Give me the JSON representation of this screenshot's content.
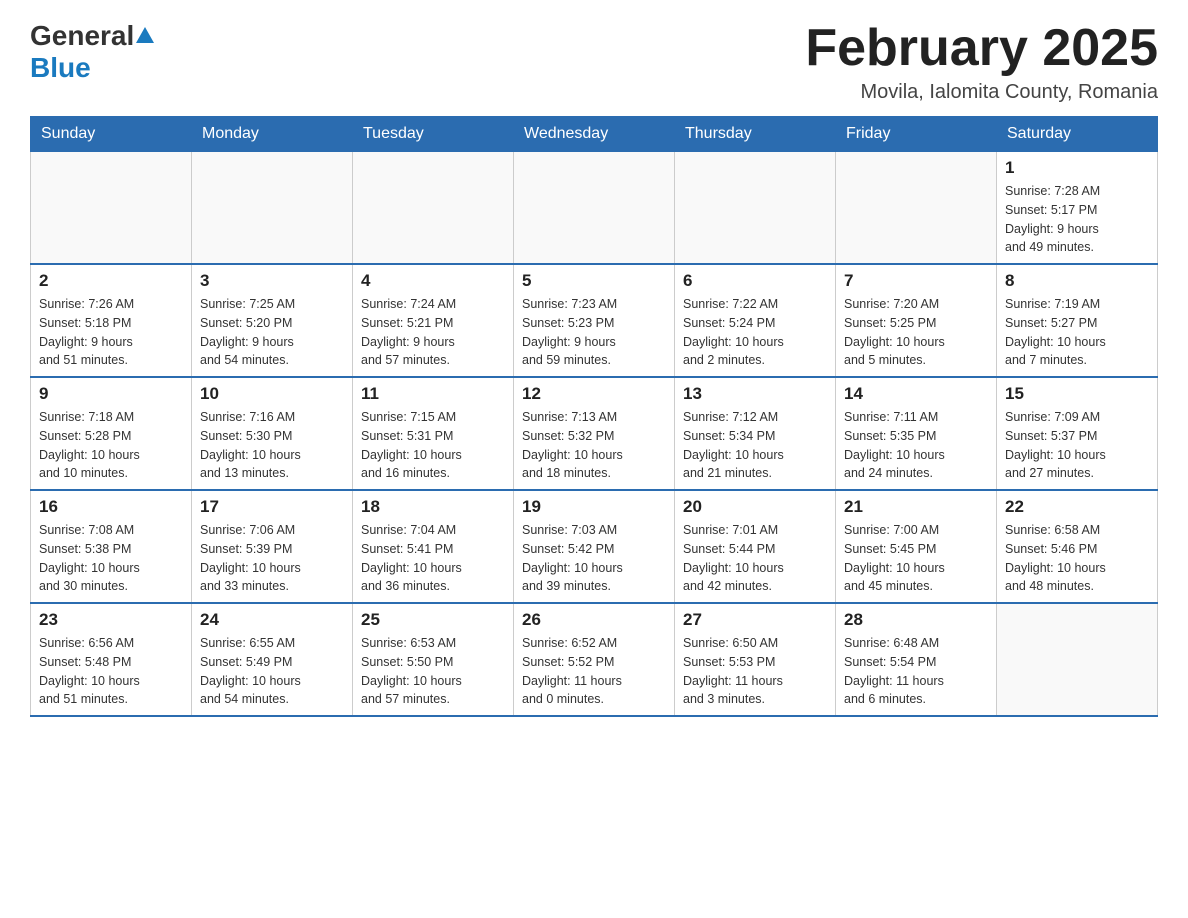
{
  "header": {
    "logo_general": "General",
    "logo_blue": "Blue",
    "month_title": "February 2025",
    "location": "Movila, Ialomita County, Romania"
  },
  "weekdays": [
    "Sunday",
    "Monday",
    "Tuesday",
    "Wednesday",
    "Thursday",
    "Friday",
    "Saturday"
  ],
  "weeks": [
    [
      {
        "day": "",
        "info": ""
      },
      {
        "day": "",
        "info": ""
      },
      {
        "day": "",
        "info": ""
      },
      {
        "day": "",
        "info": ""
      },
      {
        "day": "",
        "info": ""
      },
      {
        "day": "",
        "info": ""
      },
      {
        "day": "1",
        "info": "Sunrise: 7:28 AM\nSunset: 5:17 PM\nDaylight: 9 hours\nand 49 minutes."
      }
    ],
    [
      {
        "day": "2",
        "info": "Sunrise: 7:26 AM\nSunset: 5:18 PM\nDaylight: 9 hours\nand 51 minutes."
      },
      {
        "day": "3",
        "info": "Sunrise: 7:25 AM\nSunset: 5:20 PM\nDaylight: 9 hours\nand 54 minutes."
      },
      {
        "day": "4",
        "info": "Sunrise: 7:24 AM\nSunset: 5:21 PM\nDaylight: 9 hours\nand 57 minutes."
      },
      {
        "day": "5",
        "info": "Sunrise: 7:23 AM\nSunset: 5:23 PM\nDaylight: 9 hours\nand 59 minutes."
      },
      {
        "day": "6",
        "info": "Sunrise: 7:22 AM\nSunset: 5:24 PM\nDaylight: 10 hours\nand 2 minutes."
      },
      {
        "day": "7",
        "info": "Sunrise: 7:20 AM\nSunset: 5:25 PM\nDaylight: 10 hours\nand 5 minutes."
      },
      {
        "day": "8",
        "info": "Sunrise: 7:19 AM\nSunset: 5:27 PM\nDaylight: 10 hours\nand 7 minutes."
      }
    ],
    [
      {
        "day": "9",
        "info": "Sunrise: 7:18 AM\nSunset: 5:28 PM\nDaylight: 10 hours\nand 10 minutes."
      },
      {
        "day": "10",
        "info": "Sunrise: 7:16 AM\nSunset: 5:30 PM\nDaylight: 10 hours\nand 13 minutes."
      },
      {
        "day": "11",
        "info": "Sunrise: 7:15 AM\nSunset: 5:31 PM\nDaylight: 10 hours\nand 16 minutes."
      },
      {
        "day": "12",
        "info": "Sunrise: 7:13 AM\nSunset: 5:32 PM\nDaylight: 10 hours\nand 18 minutes."
      },
      {
        "day": "13",
        "info": "Sunrise: 7:12 AM\nSunset: 5:34 PM\nDaylight: 10 hours\nand 21 minutes."
      },
      {
        "day": "14",
        "info": "Sunrise: 7:11 AM\nSunset: 5:35 PM\nDaylight: 10 hours\nand 24 minutes."
      },
      {
        "day": "15",
        "info": "Sunrise: 7:09 AM\nSunset: 5:37 PM\nDaylight: 10 hours\nand 27 minutes."
      }
    ],
    [
      {
        "day": "16",
        "info": "Sunrise: 7:08 AM\nSunset: 5:38 PM\nDaylight: 10 hours\nand 30 minutes."
      },
      {
        "day": "17",
        "info": "Sunrise: 7:06 AM\nSunset: 5:39 PM\nDaylight: 10 hours\nand 33 minutes."
      },
      {
        "day": "18",
        "info": "Sunrise: 7:04 AM\nSunset: 5:41 PM\nDaylight: 10 hours\nand 36 minutes."
      },
      {
        "day": "19",
        "info": "Sunrise: 7:03 AM\nSunset: 5:42 PM\nDaylight: 10 hours\nand 39 minutes."
      },
      {
        "day": "20",
        "info": "Sunrise: 7:01 AM\nSunset: 5:44 PM\nDaylight: 10 hours\nand 42 minutes."
      },
      {
        "day": "21",
        "info": "Sunrise: 7:00 AM\nSunset: 5:45 PM\nDaylight: 10 hours\nand 45 minutes."
      },
      {
        "day": "22",
        "info": "Sunrise: 6:58 AM\nSunset: 5:46 PM\nDaylight: 10 hours\nand 48 minutes."
      }
    ],
    [
      {
        "day": "23",
        "info": "Sunrise: 6:56 AM\nSunset: 5:48 PM\nDaylight: 10 hours\nand 51 minutes."
      },
      {
        "day": "24",
        "info": "Sunrise: 6:55 AM\nSunset: 5:49 PM\nDaylight: 10 hours\nand 54 minutes."
      },
      {
        "day": "25",
        "info": "Sunrise: 6:53 AM\nSunset: 5:50 PM\nDaylight: 10 hours\nand 57 minutes."
      },
      {
        "day": "26",
        "info": "Sunrise: 6:52 AM\nSunset: 5:52 PM\nDaylight: 11 hours\nand 0 minutes."
      },
      {
        "day": "27",
        "info": "Sunrise: 6:50 AM\nSunset: 5:53 PM\nDaylight: 11 hours\nand 3 minutes."
      },
      {
        "day": "28",
        "info": "Sunrise: 6:48 AM\nSunset: 5:54 PM\nDaylight: 11 hours\nand 6 minutes."
      },
      {
        "day": "",
        "info": ""
      }
    ]
  ]
}
